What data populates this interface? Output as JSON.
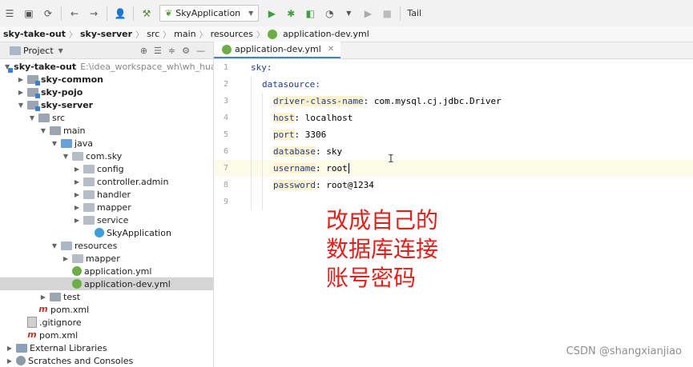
{
  "toolbar": {
    "run_config": "SkyApplication",
    "tail_label": "Tail"
  },
  "breadcrumb": [
    "sky-take-out",
    "sky-server",
    "src",
    "main",
    "resources",
    "application-dev.yml"
  ],
  "project_panel": {
    "title": "Project",
    "tree": [
      {
        "label": "sky-take-out",
        "path": "E:\\idea_workspace_wh\\wh_huangp",
        "bold": true,
        "arrow": "v",
        "icon": "module"
      },
      {
        "label": "sky-common",
        "bold": true,
        "arrow": ">",
        "icon": "module"
      },
      {
        "label": "sky-pojo",
        "bold": true,
        "arrow": ">",
        "icon": "module"
      },
      {
        "label": "sky-server",
        "bold": true,
        "arrow": "v",
        "icon": "module"
      },
      {
        "label": "src",
        "arrow": "v",
        "icon": "folder-src"
      },
      {
        "label": "main",
        "arrow": "v",
        "icon": "folder-src"
      },
      {
        "label": "java",
        "arrow": "v",
        "icon": "folder-blue"
      },
      {
        "label": "com.sky",
        "arrow": "v",
        "icon": "package"
      },
      {
        "label": "config",
        "arrow": ">",
        "icon": "package"
      },
      {
        "label": "controller.admin",
        "arrow": ">",
        "icon": "package"
      },
      {
        "label": "handler",
        "arrow": ">",
        "icon": "package"
      },
      {
        "label": "mapper",
        "arrow": ">",
        "icon": "package"
      },
      {
        "label": "service",
        "arrow": ">",
        "icon": "package"
      },
      {
        "label": "SkyApplication",
        "arrow": "",
        "icon": "class"
      },
      {
        "label": "resources",
        "arrow": "v",
        "icon": "folder"
      },
      {
        "label": "mapper",
        "arrow": ">",
        "icon": "package"
      },
      {
        "label": "application.yml",
        "arrow": "",
        "icon": "yml"
      },
      {
        "label": "application-dev.yml",
        "arrow": "",
        "icon": "yml",
        "selected": true
      },
      {
        "label": "test",
        "arrow": ">",
        "icon": "folder-src"
      },
      {
        "label": "pom.xml",
        "arrow": "",
        "icon": "maven"
      },
      {
        "label": ".gitignore",
        "arrow": "",
        "icon": "git"
      },
      {
        "label": "pom.xml",
        "arrow": "",
        "icon": "maven"
      },
      {
        "label": "External Libraries",
        "arrow": ">",
        "icon": "lib"
      },
      {
        "label": "Scratches and Consoles",
        "arrow": ">",
        "icon": "scratch"
      }
    ]
  },
  "editor": {
    "tab_label": "application-dev.yml",
    "lines": [
      {
        "num": "1",
        "key": "sky:",
        "value": ""
      },
      {
        "num": "2",
        "key": "datasource:",
        "value": ""
      },
      {
        "num": "3",
        "key": "driver-class-name",
        "value": ": com.mysql.cj.jdbc.Driver"
      },
      {
        "num": "4",
        "key": "host",
        "value": ": localhost"
      },
      {
        "num": "5",
        "key": "port",
        "value": ": 3306"
      },
      {
        "num": "6",
        "key": "database",
        "value": ": sky"
      },
      {
        "num": "7",
        "key": "username",
        "value": ": root"
      },
      {
        "num": "8",
        "key": "password",
        "value": ": root@1234"
      },
      {
        "num": "9",
        "key": "",
        "value": ""
      }
    ]
  },
  "annotation": {
    "line1": "改成自己的",
    "line2": "数据库连接",
    "line3": "账号密码"
  },
  "watermark": "CSDN @shangxianjiao"
}
